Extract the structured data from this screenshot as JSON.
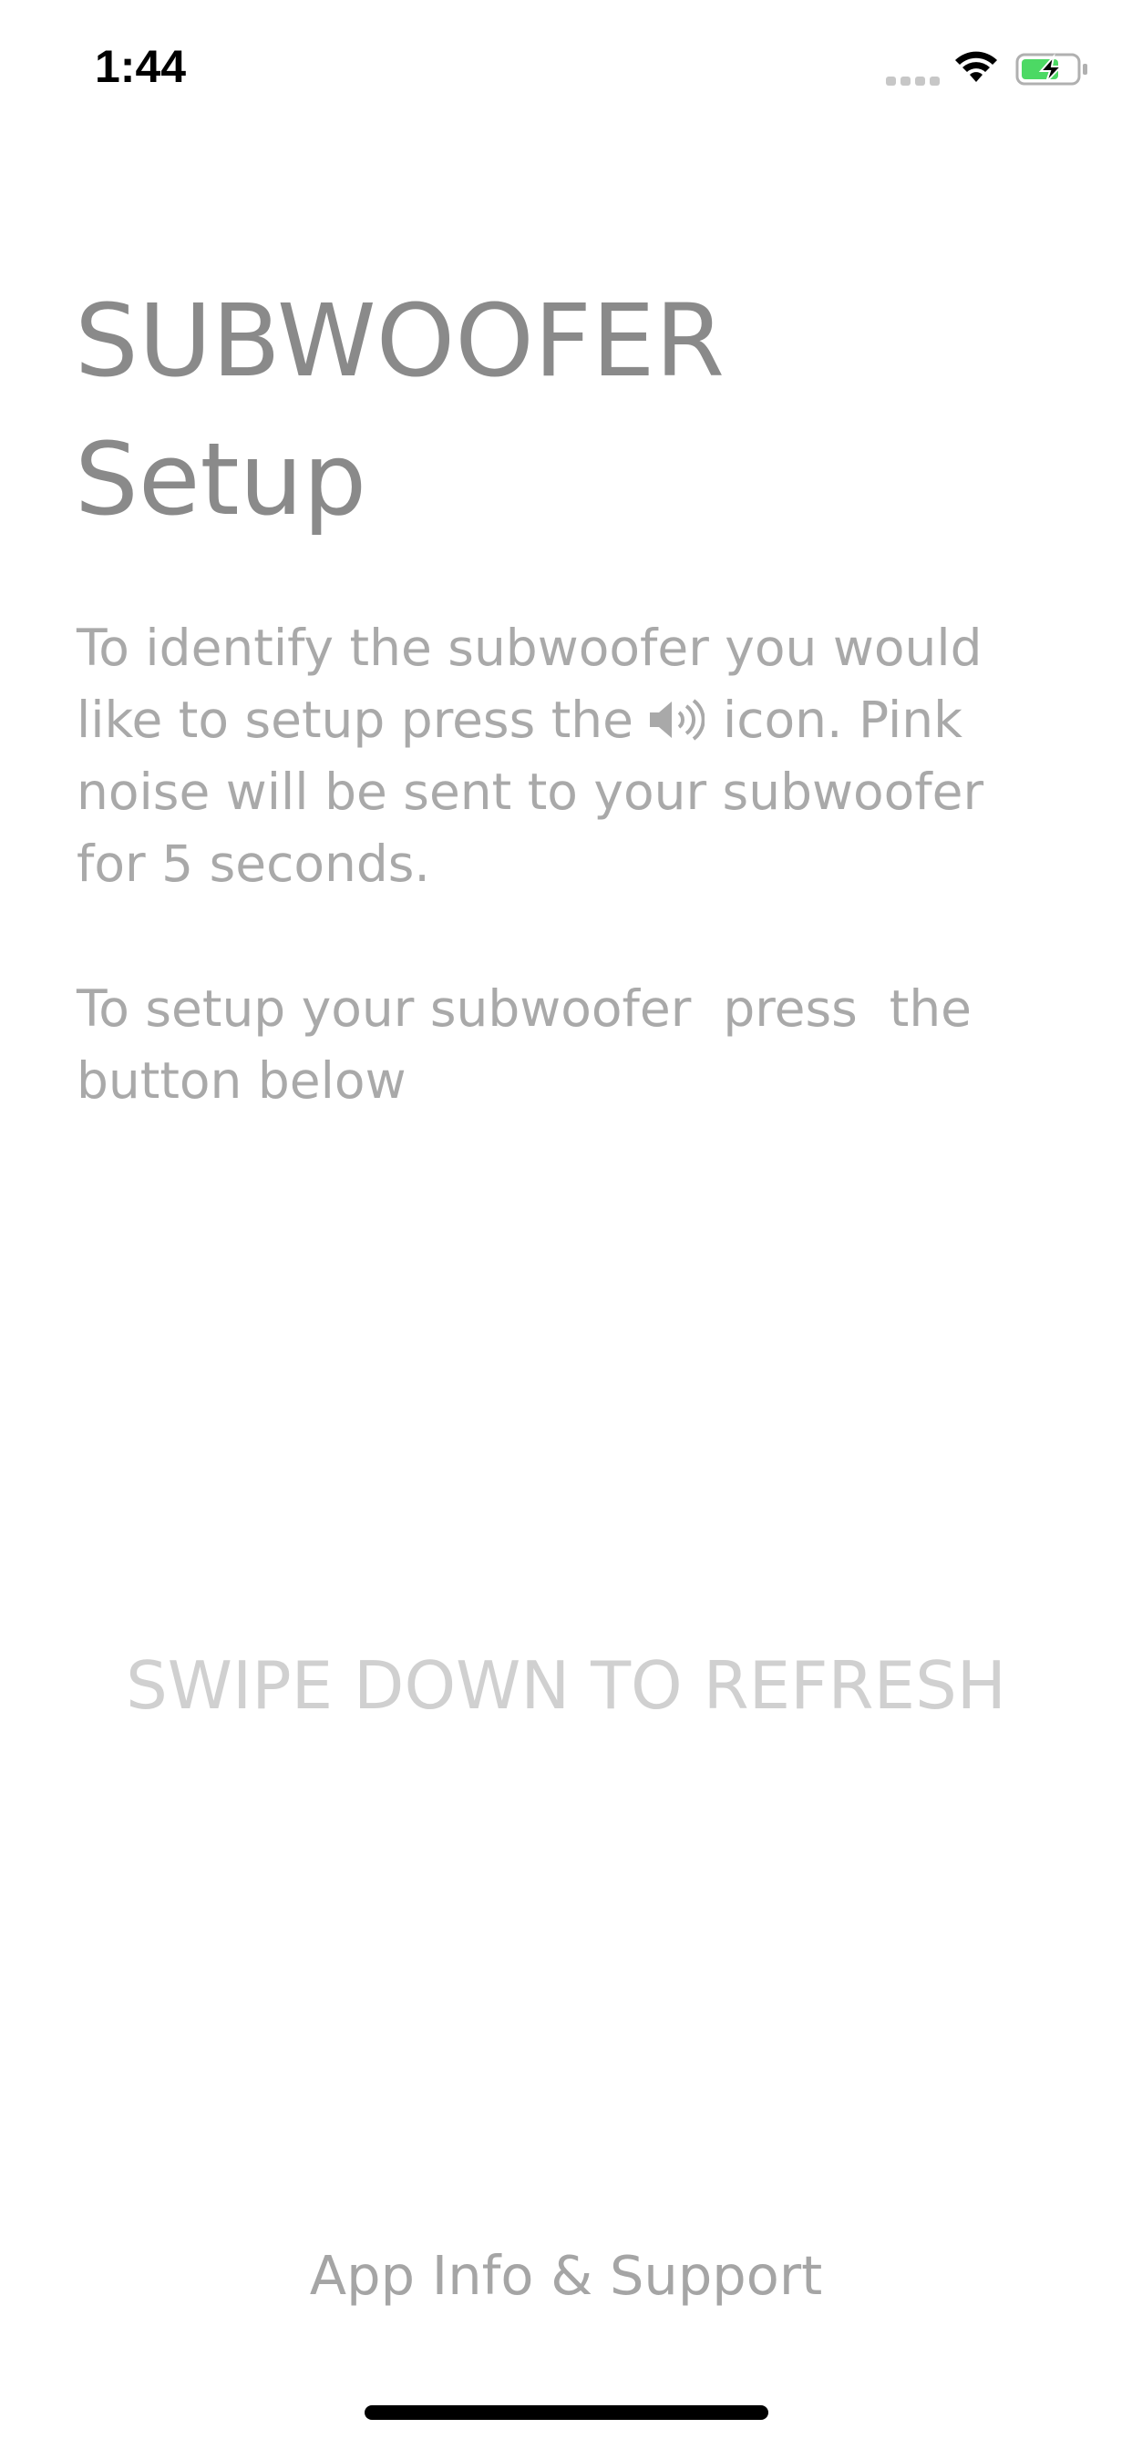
{
  "status_bar": {
    "time": "1:44"
  },
  "page": {
    "title_line1": "SUBWOOFER",
    "title_line2": "Setup",
    "description_before_icon": "To identify the subwoofer you would like to setup press the",
    "description_icon": "speaker-icon",
    "description_after_icon": "icon. Pink noise will be sent to your subwoofer for 5 seconds.",
    "instruction": "To setup your subwoofer  press  the button below",
    "refresh_hint": "SWIPE DOWN TO REFRESH",
    "support_link": "App Info & Support"
  },
  "colors": {
    "title": "#8a8a8a",
    "body_text": "#a9a9a9",
    "refresh_hint": "#d0d0d0",
    "battery_fill": "#4cd964"
  }
}
